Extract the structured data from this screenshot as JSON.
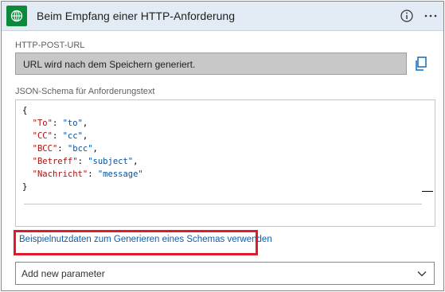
{
  "header": {
    "title": "Beim Empfang einer HTTP-Anforderung",
    "accent_color": "#0a8a3a"
  },
  "url_field": {
    "label": "HTTP-POST-URL",
    "value": "URL wird nach dem Speichern generiert."
  },
  "schema": {
    "label": "JSON-Schema für Anforderungstext",
    "lines": [
      {
        "open": "{"
      },
      {
        "key": "\"To\"",
        "value": "\"to\"",
        "comma": ","
      },
      {
        "key": "\"CC\"",
        "value": "\"cc\"",
        "comma": ","
      },
      {
        "key": "\"BCC\"",
        "value": "\"bcc\"",
        "comma": ","
      },
      {
        "key": "\"Betreff\"",
        "value": "\"subject\"",
        "comma": ","
      },
      {
        "key": "\"Nachricht\"",
        "value": "\"message\"",
        "comma": ""
      },
      {
        "close": "}"
      }
    ]
  },
  "sample_link": {
    "text": "Beispielnutzdaten zum Generieren eines Schemas verwenden",
    "highlight_color": "#e0192b"
  },
  "parameter_select": {
    "placeholder": "Add new parameter"
  },
  "icons": {
    "trigger": "http-request-icon",
    "info": "info-icon",
    "more": "more-options-icon",
    "copy": "copy-icon",
    "chevron": "chevron-down-icon"
  }
}
